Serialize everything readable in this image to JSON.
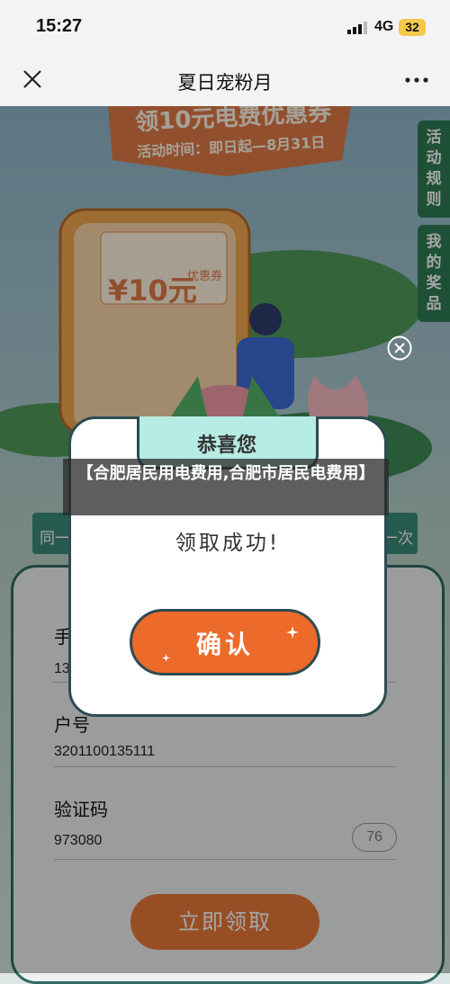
{
  "status_bar": {
    "time": "15:27",
    "network": "4G",
    "battery": "32"
  },
  "nav": {
    "title": "夏日宠粉月",
    "close_icon": "close-icon",
    "more_icon": "more-icon"
  },
  "banner": {
    "headline": "领10元电费优惠券",
    "activity_time": "活动时间：即日起—8月31日",
    "coupon_amount": "¥10元",
    "coupon_label": "优惠券"
  },
  "side_buttons": {
    "rules": [
      "活",
      "动",
      "规",
      "则"
    ],
    "prizes": [
      "我",
      "的",
      "奖",
      "品"
    ]
  },
  "form": {
    "side_left": "同一",
    "side_right": "一次",
    "phone_label": "手",
    "phone_value": "13",
    "account_label": "户号",
    "account_value": "3201100135111",
    "code_label": "验证码",
    "code_value": "973080",
    "countdown": "76",
    "claim_button": "立即领取"
  },
  "modal": {
    "title": "恭喜您",
    "message": "领取成功!",
    "confirm_button": "确认"
  },
  "caption": "【合肥居民用电费用,合肥市居民电费用】",
  "colors": {
    "accent": "#ec6a2a",
    "green": "#2f7b55",
    "mint": "#b6ece4"
  }
}
